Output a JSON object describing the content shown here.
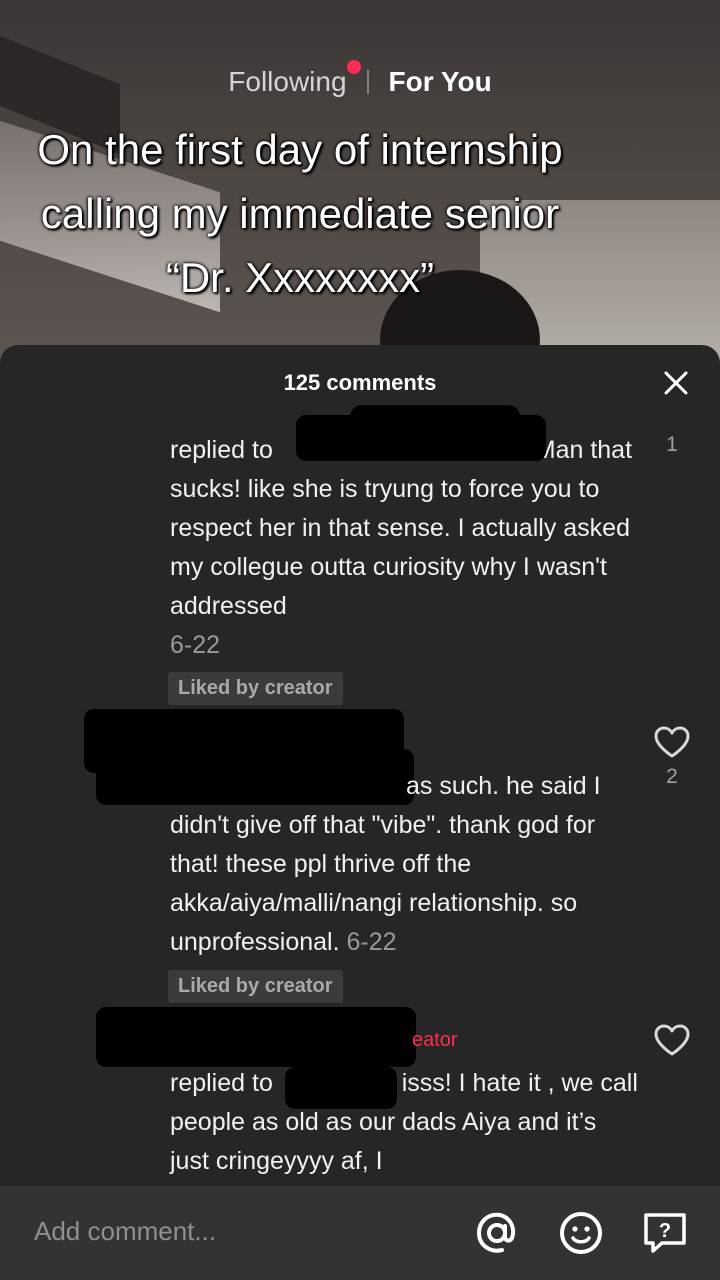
{
  "nav": {
    "following": "Following",
    "for_you": "For You"
  },
  "video": {
    "caption": "On the first day of internship calling my immediate senior “Dr. Xxxxxxxx”"
  },
  "comments_panel": {
    "count_label": "125 comments",
    "comments": [
      {
        "text_a": "replied to",
        "text_b": ". Man that sucks! like she is tryung to force you to respect her in that sense. I actually asked my collegue outta curiosity why I wasn't addressed",
        "date": "6-22",
        "liked_by_creator": "Liked by creator",
        "like_count": "1"
      },
      {
        "text_a": "as such. he said I didn't give off that \"vibe\". thank god for that! these ppl thrive off the akka/aiya/malli/nangi relationship. so unprofessional.",
        "date": "6-22",
        "liked_by_creator": "Liked by creator",
        "like_count": "2"
      },
      {
        "creator_tag": "eator",
        "text_a": "replied to",
        "text_b": "It isss! I hate it , we call people as old as our dads Aiya and it’s just cringeyyyy af, I"
      }
    ]
  },
  "input": {
    "placeholder": "Add comment..."
  },
  "icons": {
    "close": "close-icon",
    "heart": "heart-icon",
    "mention": "at-mention-icon",
    "emoji": "emoji-icon",
    "question": "question-icon"
  },
  "colors": {
    "accent": "#fe2c55",
    "sheet_bg": "#262626",
    "input_bg": "#333333"
  }
}
